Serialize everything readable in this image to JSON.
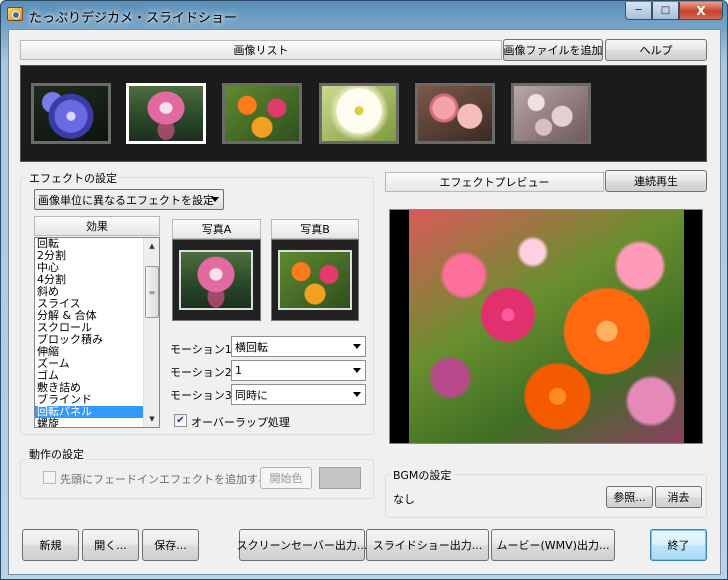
{
  "window": {
    "title": "たっぷりデジカメ・スライドショー"
  },
  "window_controls": {
    "minimize": "─",
    "maximize": "□",
    "close": "X"
  },
  "image_list": {
    "header": "画像リスト",
    "add_button": "画像ファイルを追加",
    "help_button": "ヘルプ",
    "thumbnails": [
      {
        "icon": "blue-flower-image",
        "selected": false
      },
      {
        "icon": "lotus-image",
        "selected": true
      },
      {
        "icon": "orange-flowers-image",
        "selected": false
      },
      {
        "icon": "white-lily-image",
        "selected": false
      },
      {
        "icon": "pink-roses-image",
        "selected": false
      },
      {
        "icon": "cherry-blossom-image",
        "selected": false
      }
    ]
  },
  "effect_settings": {
    "group_label": "エフェクトの設定",
    "mode_select": "画像単位に異なるエフェクトを設定",
    "effects_header": "効果",
    "effects": [
      "回転",
      "2分割",
      "中心",
      "4分割",
      "斜め",
      "スライス",
      "分解 & 合体",
      "スクロール",
      "ブロック積み",
      "伸縮",
      "ズーム",
      "ゴム",
      "敷き詰め",
      "ブラインド",
      "回転パネル",
      "螺旋"
    ],
    "selected_effect": "回転パネル",
    "photo_a": "写真A",
    "photo_b": "写真B",
    "motion1_label": "モーション1",
    "motion1_value": "横回転",
    "motion2_label": "モーション2",
    "motion2_value": "1",
    "motion3_label": "モーション3",
    "motion3_value": "同時に",
    "overlap_label": "オーバーラップ処理",
    "overlap_checked": true
  },
  "behavior_settings": {
    "group_label": "動作の設定",
    "fade_in_label": "先頭にフェードインエフェクトを追加する",
    "fade_in_checked": false,
    "start_color_button": "開始色",
    "start_color": "#c4c4c4"
  },
  "preview": {
    "header": "エフェクトプレビュー",
    "continuous_button": "連続再生"
  },
  "bgm": {
    "group_label": "BGMの設定",
    "value": "なし",
    "browse_button": "参照...",
    "clear_button": "消去"
  },
  "footer": {
    "new_button": "新規",
    "open_button": "開く...",
    "save_button": "保存...",
    "screensaver_button": "スクリーンセーバー出力...",
    "slideshow_button": "スライドショー出力...",
    "movie_button": "ムービー(WMV)出力...",
    "exit_button": "終了"
  }
}
